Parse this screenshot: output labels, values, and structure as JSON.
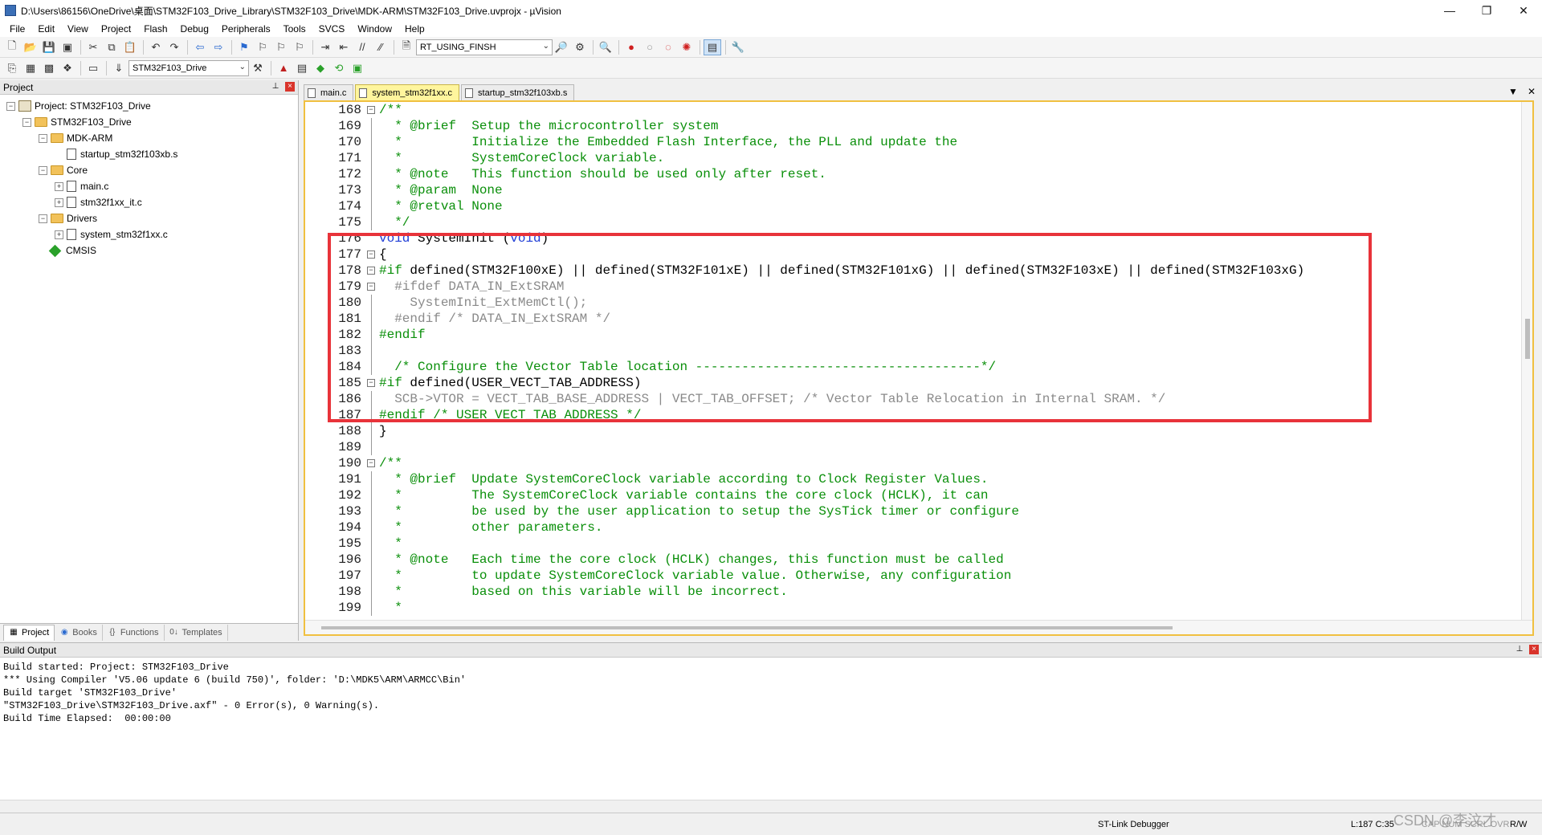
{
  "window": {
    "title": "D:\\Users\\86156\\OneDrive\\桌面\\STM32F103_Drive_Library\\STM32F103_Drive\\MDK-ARM\\STM32F103_Drive.uvprojx - µVision",
    "minimize": "—",
    "maximize": "❐",
    "close": "✕"
  },
  "menu": [
    "File",
    "Edit",
    "View",
    "Project",
    "Flash",
    "Debug",
    "Peripherals",
    "Tools",
    "SVCS",
    "Window",
    "Help"
  ],
  "toolbar1": {
    "define_combo": "RT_USING_FINSH"
  },
  "toolbar2": {
    "target_combo": "STM32F103_Drive"
  },
  "project_panel": {
    "title": "Project",
    "tree": [
      {
        "label": "Project: STM32F103_Drive",
        "level": 0,
        "type": "project",
        "exp": "−"
      },
      {
        "label": "STM32F103_Drive",
        "level": 1,
        "type": "folder",
        "exp": "−"
      },
      {
        "label": "MDK-ARM",
        "level": 2,
        "type": "folder",
        "exp": "−"
      },
      {
        "label": "startup_stm32f103xb.s",
        "level": 3,
        "type": "file",
        "exp": ""
      },
      {
        "label": "Core",
        "level": 2,
        "type": "folder",
        "exp": "−"
      },
      {
        "label": "main.c",
        "level": 3,
        "type": "file",
        "exp": "+"
      },
      {
        "label": "stm32f1xx_it.c",
        "level": 3,
        "type": "file",
        "exp": "+"
      },
      {
        "label": "Drivers",
        "level": 2,
        "type": "folder",
        "exp": "−"
      },
      {
        "label": "system_stm32f1xx.c",
        "level": 3,
        "type": "file",
        "exp": "+"
      },
      {
        "label": "CMSIS",
        "level": 2,
        "type": "component",
        "exp": ""
      }
    ],
    "tabs": [
      {
        "label": "Project",
        "icon": "▦"
      },
      {
        "label": "Books",
        "icon": "◉"
      },
      {
        "label": "Functions",
        "icon": "{}"
      },
      {
        "label": "Templates",
        "icon": "0↓"
      }
    ]
  },
  "editor": {
    "tabs": [
      {
        "label": "main.c",
        "active": false
      },
      {
        "label": "system_stm32f1xx.c",
        "active": true
      },
      {
        "label": "startup_stm32f103xb.s",
        "active": false
      }
    ],
    "lines": [
      {
        "n": "168",
        "fold": "box-minus",
        "style": "comment",
        "text": "/**"
      },
      {
        "n": "169",
        "fold": "vline",
        "style": "comment",
        "text": "  * @brief  Setup the microcontroller system"
      },
      {
        "n": "170",
        "fold": "vline",
        "style": "comment",
        "text": "  *         Initialize the Embedded Flash Interface, the PLL and update the"
      },
      {
        "n": "171",
        "fold": "vline",
        "style": "comment",
        "text": "  *         SystemCoreClock variable."
      },
      {
        "n": "172",
        "fold": "vline",
        "style": "comment",
        "text": "  * @note   This function should be used only after reset."
      },
      {
        "n": "173",
        "fold": "vline",
        "style": "comment",
        "text": "  * @param  None"
      },
      {
        "n": "174",
        "fold": "vline",
        "style": "comment",
        "text": "  * @retval None"
      },
      {
        "n": "175",
        "fold": "end",
        "style": "comment",
        "text": "  */"
      },
      {
        "n": "176",
        "fold": "",
        "style": "normal",
        "text": "void SystemInit (void)"
      },
      {
        "n": "177",
        "fold": "box-minus",
        "style": "normal",
        "text": "{"
      },
      {
        "n": "178",
        "fold": "box-minus",
        "style": "normal",
        "text": "#if defined(STM32F100xE) || defined(STM32F101xE) || defined(STM32F101xG) || defined(STM32F103xE) || defined(STM32F103xG)"
      },
      {
        "n": "179",
        "fold": "box-minus",
        "style": "dim",
        "text": "  #ifdef DATA_IN_ExtSRAM"
      },
      {
        "n": "180",
        "fold": "vline",
        "style": "dim",
        "text": "    SystemInit_ExtMemCtl();"
      },
      {
        "n": "181",
        "fold": "end",
        "style": "dim",
        "text": "  #endif /* DATA_IN_ExtSRAM */"
      },
      {
        "n": "182",
        "fold": "end",
        "style": "normal",
        "text": "#endif"
      },
      {
        "n": "183",
        "fold": "vline",
        "style": "normal",
        "text": ""
      },
      {
        "n": "184",
        "fold": "vline",
        "style": "comment",
        "text": "  /* Configure the Vector Table location -------------------------------------*/"
      },
      {
        "n": "185",
        "fold": "box-minus",
        "style": "normal",
        "text": "#if defined(USER_VECT_TAB_ADDRESS)"
      },
      {
        "n": "186",
        "fold": "vline",
        "style": "dim",
        "text": "  SCB->VTOR = VECT_TAB_BASE_ADDRESS | VECT_TAB_OFFSET; /* Vector Table Relocation in Internal SRAM. */"
      },
      {
        "n": "187",
        "fold": "end",
        "style": "normal",
        "text": "#endif /* USER_VECT_TAB_ADDRESS */"
      },
      {
        "n": "188",
        "fold": "vline",
        "style": "normal",
        "text": "}"
      },
      {
        "n": "189",
        "fold": "end",
        "style": "normal",
        "text": ""
      },
      {
        "n": "190",
        "fold": "box-minus",
        "style": "comment",
        "text": "/**"
      },
      {
        "n": "191",
        "fold": "vline",
        "style": "comment",
        "text": "  * @brief  Update SystemCoreClock variable according to Clock Register Values."
      },
      {
        "n": "192",
        "fold": "vline",
        "style": "comment",
        "text": "  *         The SystemCoreClock variable contains the core clock (HCLK), it can"
      },
      {
        "n": "193",
        "fold": "vline",
        "style": "comment",
        "text": "  *         be used by the user application to setup the SysTick timer or configure"
      },
      {
        "n": "194",
        "fold": "vline",
        "style": "comment",
        "text": "  *         other parameters."
      },
      {
        "n": "195",
        "fold": "vline",
        "style": "comment",
        "text": "  *"
      },
      {
        "n": "196",
        "fold": "vline",
        "style": "comment",
        "text": "  * @note   Each time the core clock (HCLK) changes, this function must be called"
      },
      {
        "n": "197",
        "fold": "vline",
        "style": "comment",
        "text": "  *         to update SystemCoreClock variable value. Otherwise, any configuration"
      },
      {
        "n": "198",
        "fold": "vline",
        "style": "comment",
        "text": "  *         based on this variable will be incorrect."
      },
      {
        "n": "199",
        "fold": "vline",
        "style": "comment",
        "text": "  *"
      }
    ]
  },
  "build_output": {
    "title": "Build Output",
    "lines": [
      "Build started: Project: STM32F103_Drive",
      "*** Using Compiler 'V5.06 update 6 (build 750)', folder: 'D:\\MDK5\\ARM\\ARMCC\\Bin'",
      "Build target 'STM32F103_Drive'",
      "\"STM32F103_Drive\\STM32F103_Drive.axf\" - 0 Error(s), 0 Warning(s).",
      "Build Time Elapsed:  00:00:00"
    ]
  },
  "status": {
    "debugger": "ST-Link Debugger",
    "position": "L:187 C:35",
    "caps": "CAP NUM SCRL OVR",
    "rw": "R/W"
  },
  "watermark": "CSDN @李汶才",
  "colors": {
    "highlight_box": "#e8333a",
    "active_tab": "#fff59d",
    "comment": "#0a8f0a",
    "keyword": "#1f3dd6"
  }
}
